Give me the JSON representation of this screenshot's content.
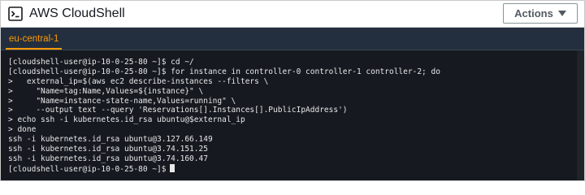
{
  "header": {
    "title": "AWS CloudShell",
    "icon": "cloudshell-terminal-icon",
    "actions_label": "Actions"
  },
  "tabs": [
    {
      "label": "eu-central-1",
      "active": true
    }
  ],
  "terminal": {
    "lines": [
      "[cloudshell-user@ip-10-0-25-80 ~]$ cd ~/",
      "[cloudshell-user@ip-10-0-25-80 ~]$ for instance in controller-0 controller-1 controller-2; do",
      ">   external_ip=$(aws ec2 describe-instances --filters \\",
      ">     \"Name=tag:Name,Values=${instance}\" \\",
      ">     \"Name=instance-state-name,Values=running\" \\",
      ">     --output text --query 'Reservations[].Instances[].PublicIpAddress')",
      "> echo ssh -i kubernetes.id_rsa ubuntu@$external_ip",
      "> done",
      "ssh -i kubernetes.id_rsa ubuntu@3.127.66.149",
      "ssh -i kubernetes.id_rsa ubuntu@3.74.151.25",
      "ssh -i kubernetes.id_rsa ubuntu@3.74.160.47"
    ],
    "prompt": "[cloudshell-user@ip-10-0-25-80 ~]$"
  },
  "colors": {
    "accent": "#ff9900",
    "terminal_bg": "#16191f",
    "tabbar_bg": "#232f3e"
  }
}
